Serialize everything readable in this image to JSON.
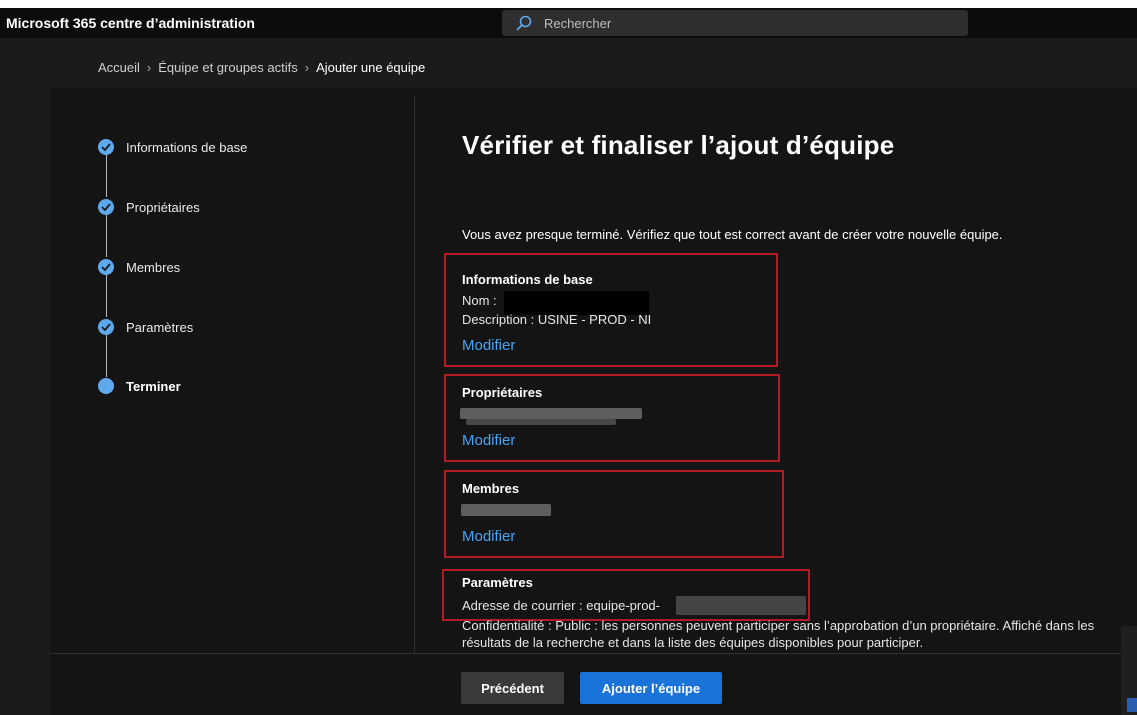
{
  "header": {
    "app_title": "Microsoft 365 centre d’administration",
    "search_placeholder": "Rechercher"
  },
  "breadcrumb": {
    "items": [
      "Accueil",
      "Équipe et groupes actifs",
      "Ajouter une équipe"
    ]
  },
  "stepper": {
    "steps": [
      {
        "label": "Informations de base",
        "state": "done"
      },
      {
        "label": "Propriétaires",
        "state": "done"
      },
      {
        "label": "Membres",
        "state": "done"
      },
      {
        "label": "Paramètres",
        "state": "done"
      },
      {
        "label": "Terminer",
        "state": "current"
      }
    ]
  },
  "main": {
    "heading": "Vérifier et finaliser l’ajout d’équipe",
    "intro": "Vous avez presque terminé. Vérifiez que tout est correct avant de créer votre nouvelle équipe.",
    "basic_info": {
      "title": "Informations de base",
      "name_label": "Nom :",
      "description": "Description : USINE - PROD - NI",
      "edit": "Modifier"
    },
    "owners": {
      "title": "Propriétaires",
      "edit": "Modifier"
    },
    "members": {
      "title": "Membres",
      "edit": "Modifier"
    },
    "settings": {
      "title": "Paramètres",
      "email": "Adresse de courrier : equipe-prod-",
      "privacy_line1": "Confidentialité : Public : les personnes peuvent participer sans l’approbation d’un propriétaire. Affiché dans les",
      "privacy_line2": "résultats de la recherche et dans la liste des équipes disponibles pour participer."
    }
  },
  "footer": {
    "prev_label": "Précédent",
    "add_label": "Ajouter l’équipe"
  },
  "colors": {
    "accent": "#5ea8ee",
    "link": "#4aa3ef",
    "primary_button": "#1a73d9",
    "highlight_border": "#b01c22"
  }
}
